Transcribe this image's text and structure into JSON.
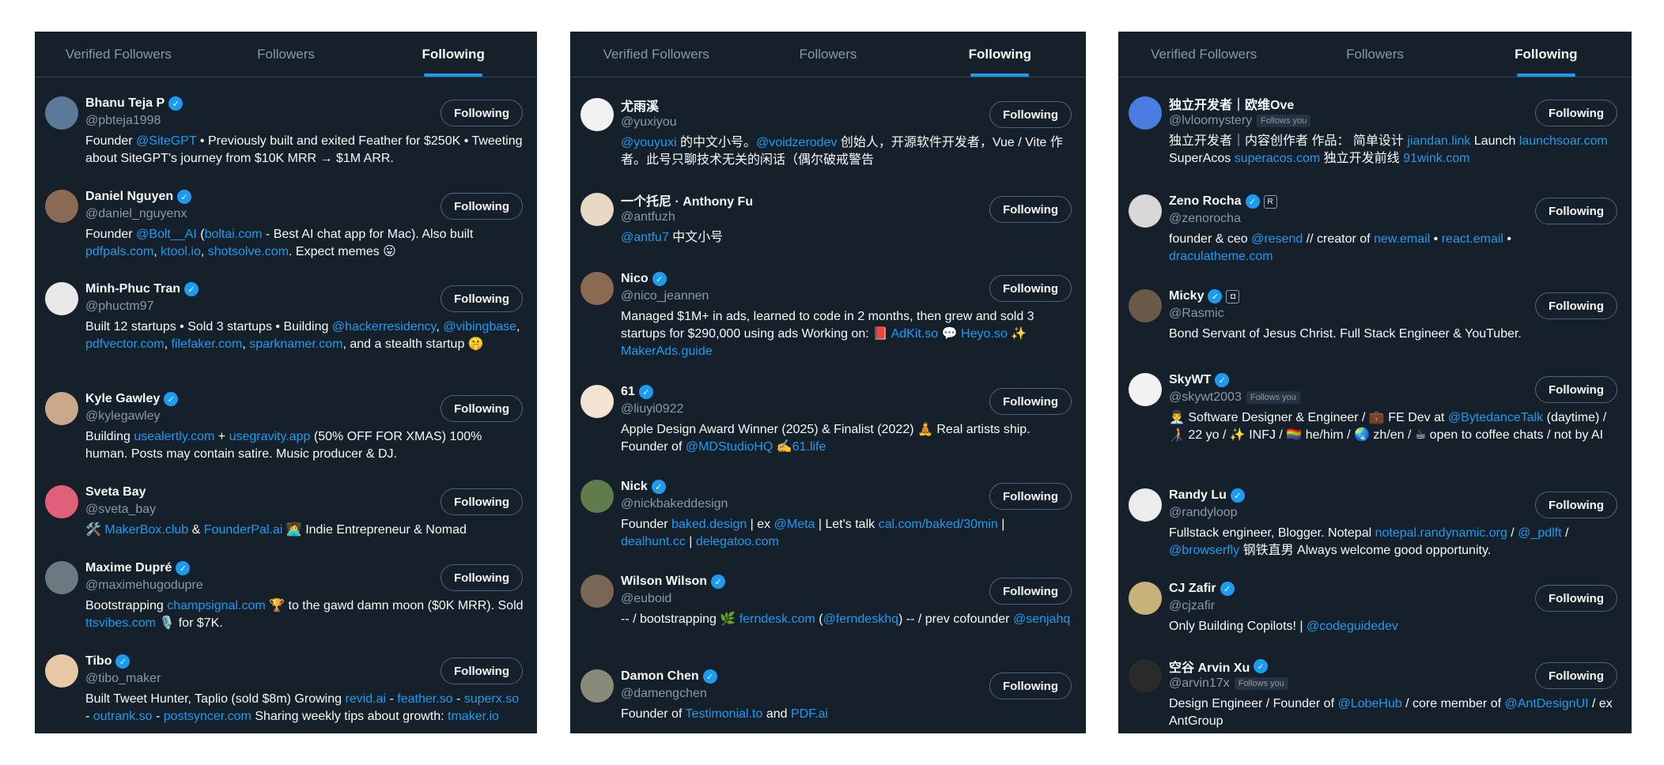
{
  "panels": [
    {
      "tabs": [
        {
          "label": "Verified Followers",
          "active": false
        },
        {
          "label": "Followers",
          "active": false
        },
        {
          "label": "Following",
          "active": true
        }
      ],
      "users": [
        {
          "name": "Bhanu Teja P",
          "verified": true,
          "handle": "@pbteja1998",
          "bio": "Founder @SiteGPT • Previously built and exited Feather for $250K • Tweeting about SiteGPT's journey from $10K MRR → $1M ARR.",
          "links": [
            "@SiteGPT"
          ],
          "button": "Following",
          "avatar_color": "#5b7a99"
        },
        {
          "name": "Daniel Nguyen",
          "verified": true,
          "handle": "@daniel_nguyenx",
          "bio": "Founder @Bolt__AI (boltai.com - Best AI chat app for Mac). Also built pdfpals.com, ktool.io, shotsolve.com. Expect memes 😛",
          "links": [
            "@Bolt__AI",
            "boltai.com",
            "pdfpals.com",
            "ktool.io",
            "shotsolve.com"
          ],
          "button": "Following",
          "avatar_color": "#8a6a52"
        },
        {
          "name": "Minh-Phuc Tran",
          "verified": true,
          "handle": "@phuctm97",
          "bio": "Built 12 startups • Sold 3 startups • Building @hackerresidency, @vibingbase, pdfvector.com, filefaker.com, sparknamer.com, and a stealth startup 🤫",
          "links": [
            "@hackerresidency",
            "@vibingbase",
            "pdfvector.com",
            "filefaker.com",
            "sparknamer.com"
          ],
          "button": "Following",
          "avatar_color": "#e8e8e8"
        },
        {
          "name": "Kyle Gawley",
          "verified": true,
          "handle": "@kylegawley",
          "bio": "Building usealertly.com + usegravity.app (50% OFF FOR XMAS) 100% human. Posts may contain satire. Music producer & DJ.",
          "links": [
            "usealertly.com",
            "usegravity.app"
          ],
          "button": "Following",
          "avatar_color": "#c9a98a"
        },
        {
          "name": "Sveta Bay",
          "verified": false,
          "handle": "@sveta_bay",
          "bio": "🛠️ MakerBox.club & FounderPal.ai 👩‍💻 Indie Entrepreneur & Nomad",
          "links": [
            "MakerBox.club",
            "FounderPal.ai"
          ],
          "button": "Following",
          "avatar_color": "#e0607a"
        },
        {
          "name": "Maxime Dupré",
          "verified": true,
          "handle": "@maximehugodupre",
          "bio": "Bootstrapping champsignal.com 🏆 to the gawd damn moon ($0K MRR). Sold ttsvibes.com 🎙️ for $7K.",
          "links": [
            "champsignal.com",
            "ttsvibes.com"
          ],
          "button": "Following",
          "avatar_color": "#6b7a80"
        },
        {
          "name": "Tibo",
          "verified": true,
          "handle": "@tibo_maker",
          "bio": "Built Tweet Hunter, Taplio (sold $8m) Growing revid.ai - feather.so - superx.so - outrank.so - postsyncer.com Sharing weekly tips about growth: tmaker.io",
          "links": [
            "revid.ai",
            "feather.so",
            "superx.so",
            "outrank.so",
            "postsyncer.com",
            "tmaker.io"
          ],
          "button": "Following",
          "avatar_color": "#e8c9a5"
        }
      ]
    },
    {
      "tabs": [
        {
          "label": "Verified Followers",
          "active": false
        },
        {
          "label": "Followers",
          "active": false
        },
        {
          "label": "Following",
          "active": true
        }
      ],
      "users": [
        {
          "name": "尤雨溪",
          "verified": false,
          "handle": "@yuxiyou",
          "bio": "@youyuxi 的中文小号。@voidzerodev 创始人，开源软件开发者，Vue / Vite 作者。此号只聊技术无关的闲话（偶尔破戒警告",
          "links": [
            "@youyuxi",
            "@voidzerodev"
          ],
          "button": "Following",
          "avatar_color": "#f2f2f2"
        },
        {
          "name": "一个托尼 · Anthony Fu",
          "verified": false,
          "handle": "@antfuzh",
          "bio": "@antfu7 中文小号",
          "links": [
            "@antfu7"
          ],
          "button": "Following",
          "avatar_color": "#e9d8c4"
        },
        {
          "name": "Nico",
          "verified": true,
          "handle": "@nico_jeannen",
          "bio": "Managed $1M+ in ads, learned to code in 2 months, then grew and sold 3 startups for $290,000 using ads Working on: 📕 AdKit.so 💬 Heyo.so ✨ MakerAds.guide",
          "links": [
            "AdKit.so",
            "Heyo.so",
            "MakerAds.guide"
          ],
          "button": "Following",
          "avatar_color": "#8a6a50"
        },
        {
          "name": "61",
          "verified": true,
          "handle": "@liuyi0922",
          "bio": " Apple Design Award Winner (2025) & Finalist (2022) 🧘 Real artists ship. Founder of @MDStudioHQ ✍️61.life",
          "links": [
            "@MDStudioHQ",
            "61.life"
          ],
          "button": "Following",
          "avatar_color": "#f3e3d3"
        },
        {
          "name": "Nick",
          "verified": true,
          "handle": "@nickbakeddesign",
          "bio": "Founder baked.design | ex @Meta | Let's talk cal.com/baked/30min | dealhunt.cc | delegatoo.com",
          "links": [
            "baked.design",
            "@Meta",
            "cal.com/baked/30min",
            "dealhunt.cc",
            "delegatoo.com"
          ],
          "button": "Following",
          "avatar_color": "#5f7d4a"
        },
        {
          "name": "Wilson Wilson",
          "verified": true,
          "handle": "@euboid",
          "bio": "-- / bootstrapping 🌿 ferndesk.com (@ferndeskhq) -- / prev cofounder @senjahq",
          "links": [
            "ferndesk.com",
            "@ferndeskhq",
            "@senjahq"
          ],
          "button": "Following",
          "avatar_color": "#7a6654"
        },
        {
          "name": "Damon Chen",
          "verified": true,
          "handle": "@damengchen",
          "bio": "Founder of Testimonial.to and PDF.ai",
          "links": [
            "Testimonial.to",
            "PDF.ai"
          ],
          "button": "Following",
          "avatar_color": "#8a8a7a"
        }
      ]
    },
    {
      "tabs": [
        {
          "label": "Verified Followers",
          "active": false
        },
        {
          "label": "Followers",
          "active": false
        },
        {
          "label": "Following",
          "active": true
        }
      ],
      "users": [
        {
          "name": "独立开发者｜欧维Ove",
          "verified": false,
          "handle": "@lvloomystery",
          "follows_you": "Follows you",
          "bio": "独立开发者｜内容创作者 作品： 简单设计 jiandan.link Launch launchsoar.com SuperAcos superacos.com 独立开发前线 91wink.com",
          "links": [
            "jiandan.link",
            "launchsoar.com",
            "superacos.com",
            "91wink.com"
          ],
          "button": "Following",
          "avatar_color": "#4a7de0"
        },
        {
          "name": "Zeno Rocha",
          "verified": true,
          "extra_badge": "R",
          "handle": "@zenorocha",
          "bio": "founder & ceo @resend // creator of new.email • react.email • draculatheme.com",
          "links": [
            "@resend",
            "new.email",
            "react.email",
            "draculatheme.com"
          ],
          "button": "Following",
          "avatar_color": "#d8d8d8"
        },
        {
          "name": "Micky",
          "verified": true,
          "extra_badge": "◘",
          "handle": "@Rasmic",
          "bio": "Bond Servant of Jesus Christ. Full Stack Engineer & YouTuber.",
          "links": [],
          "button": "Following",
          "avatar_color": "#6a5a4a"
        },
        {
          "name": "SkyWT",
          "verified": true,
          "handle": "@skywt2003",
          "follows_you": "Follows you",
          "bio": "👨‍💼 Software Designer & Engineer / 💼 FE Dev at @BytedanceTalk (daytime) / 🧑‍🦯 22 yo / ✨ INFJ / 🏳️‍🌈 he/him / 🌏 zh/en / ☕ open to coffee chats / not by AI",
          "links": [
            "@BytedanceTalk"
          ],
          "button": "Following",
          "avatar_color": "#f2f2f2"
        },
        {
          "name": "Randy Lu",
          "verified": true,
          "handle": "@randyloop",
          "bio": "Fullstack engineer, Blogger. Notepal notepal.randynamic.org / @_pdlft / @browserfly 钢铁直男 Always welcome good opportunity.",
          "links": [
            "notepal.randynamic.org",
            "@_pdlft",
            "@browserfly"
          ],
          "button": "Following",
          "avatar_color": "#ececec"
        },
        {
          "name": "CJ Zafir",
          "verified": true,
          "handle": "@cjzafir",
          "bio": "Only Building Copilots! | @codeguidedev",
          "links": [
            "@codeguidedev"
          ],
          "button": "Following",
          "avatar_color": "#c9b27a"
        },
        {
          "name": "空谷 Arvin Xu",
          "verified": true,
          "handle": "@arvin17x",
          "follows_you": "Follows you",
          "bio": "Design Engineer / Founder of @LobeHub / core member of @AntDesignUI / ex AntGroup",
          "links": [
            "@LobeHub",
            "@AntDesignUI"
          ],
          "button": "Following",
          "avatar_color": "#2a2a2a"
        }
      ]
    }
  ]
}
